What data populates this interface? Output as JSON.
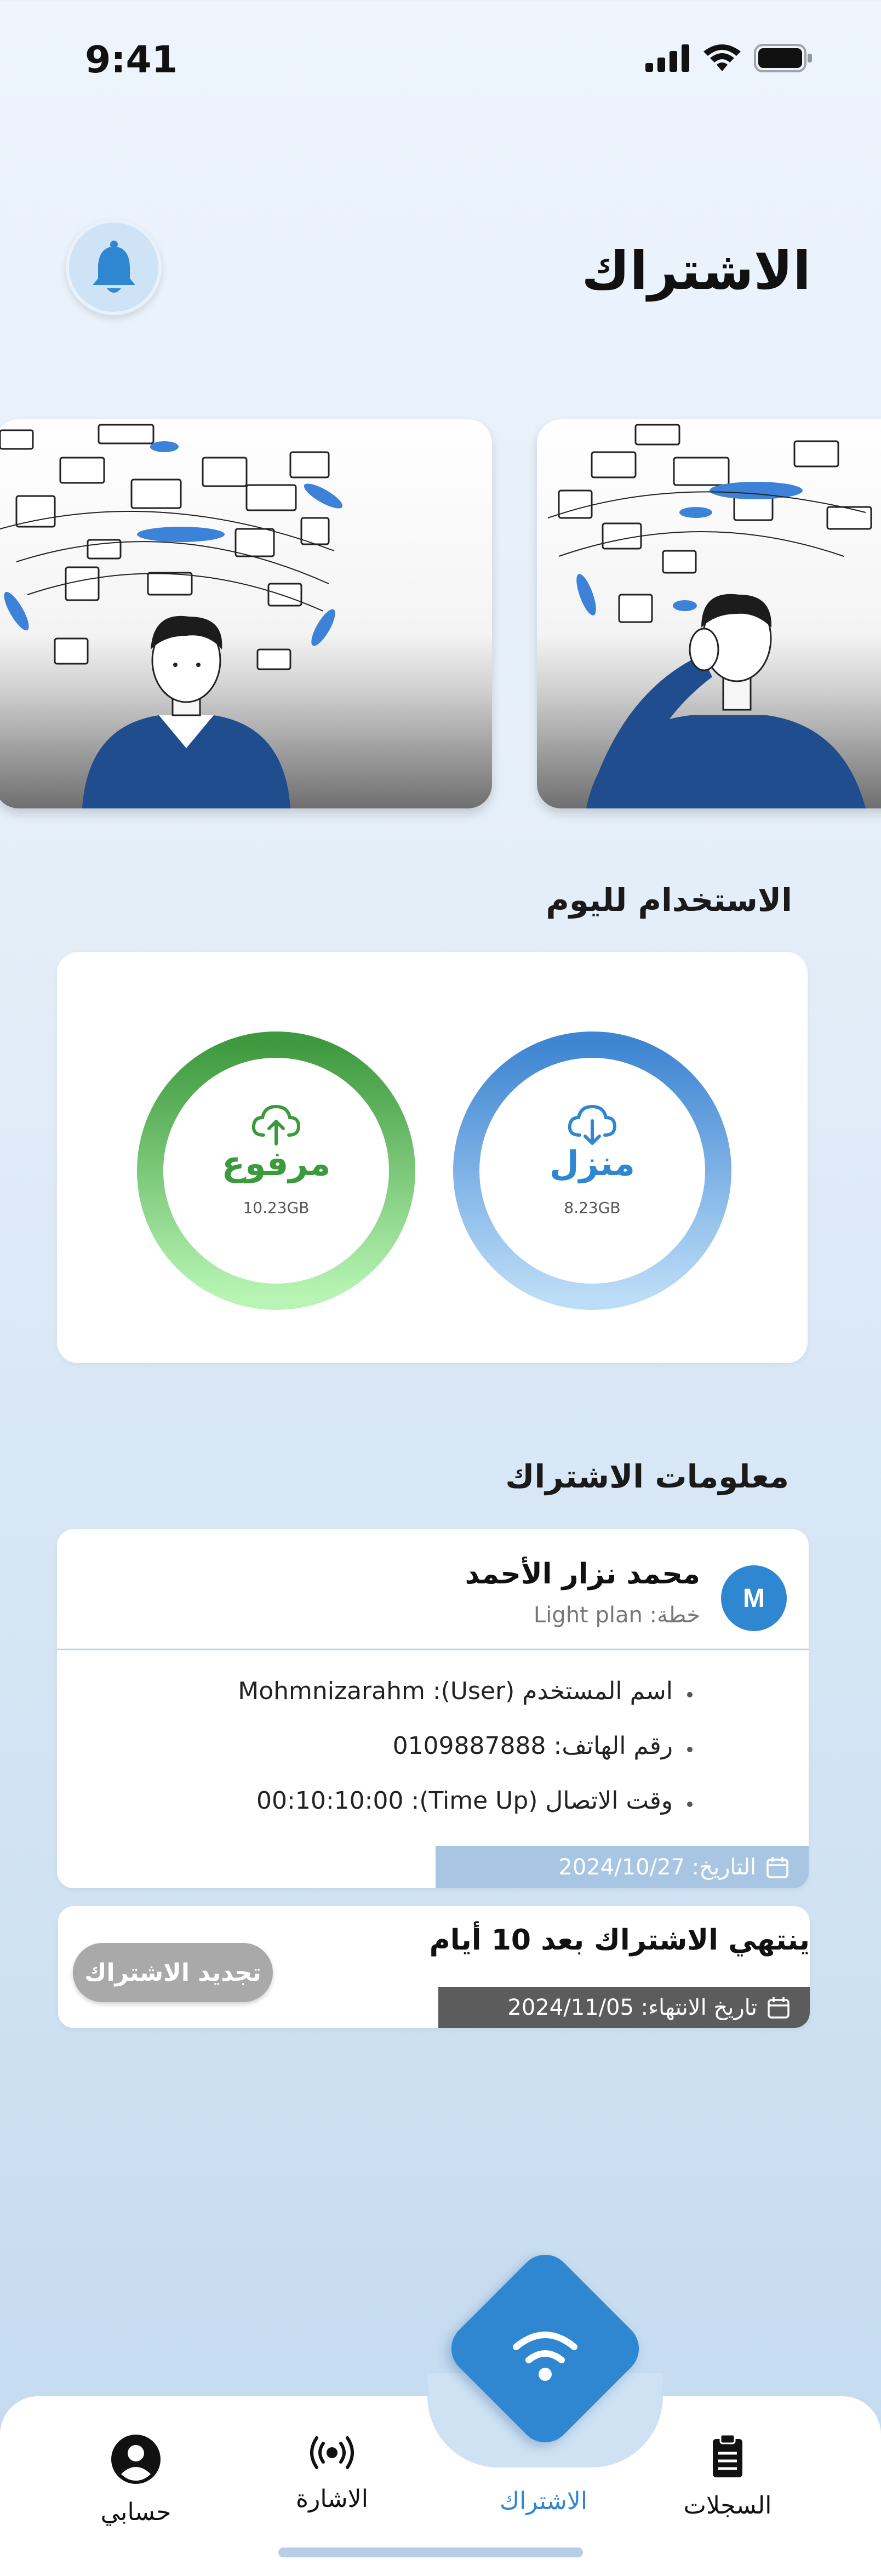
{
  "status_bar": {
    "time": "9:41"
  },
  "header": {
    "title": "الاشتراك"
  },
  "usage": {
    "section_title": "الاستخدام لليوم",
    "download": {
      "label": "منزل",
      "value": "8.23GB"
    },
    "upload": {
      "label": "مرفوع",
      "value": "10.23GB"
    }
  },
  "subscription": {
    "section_title": "معلومات الاشتراك",
    "avatar_initial": "M",
    "user_name": "محمد نزار الأحمد",
    "plan": "خطة: Light plan",
    "details": [
      "اسم المستخدم (User): Mohmnizarahm",
      "رقم الهاتف: 0109887888",
      "وقت الاتصال (Time Up): 00:10:10:00"
    ],
    "date": "التاريخ: 2024/10/27"
  },
  "expiry": {
    "message": "ينتهي الاشتراك بعد 10 أيام",
    "date": "تاريخ الانتهاء: 2024/11/05",
    "renew_label": "تجديد الاشتراك"
  },
  "tabs": [
    {
      "label": "السجلات",
      "icon": "clipboard-icon"
    },
    {
      "label": "الاشتراك",
      "icon": "wifi-icon",
      "active": true
    },
    {
      "label": "الاشارة",
      "icon": "signal-icon"
    },
    {
      "label": "حسابي",
      "icon": "account-icon"
    }
  ],
  "colors": {
    "accent": "#2f86d1",
    "upload": "#3a9a3c",
    "download": "#2f86d1"
  }
}
